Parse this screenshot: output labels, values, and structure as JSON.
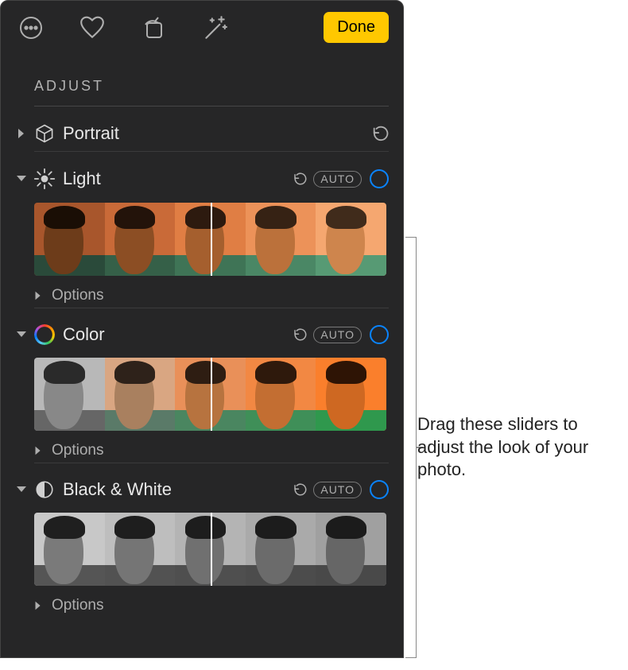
{
  "toolbar": {
    "done_label": "Done"
  },
  "adjust": {
    "title": "ADJUST"
  },
  "sections": {
    "portrait": {
      "label": "Portrait"
    },
    "light": {
      "label": "Light",
      "auto": "AUTO",
      "options": "Options"
    },
    "color": {
      "label": "Color",
      "auto": "AUTO",
      "options": "Options"
    },
    "bw": {
      "label": "Black & White",
      "auto": "AUTO",
      "options": "Options"
    }
  },
  "callout": {
    "text": "Drag these sliders to adjust the look of your photo."
  }
}
